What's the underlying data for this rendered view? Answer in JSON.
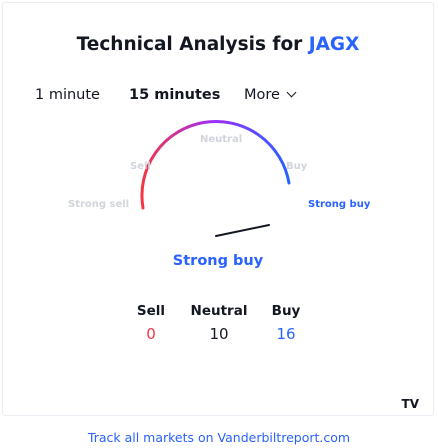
{
  "header": {
    "title_prefix": "Technical Analysis for ",
    "symbol": "JAGX"
  },
  "tabs": [
    {
      "label": "1 minute",
      "active": false
    },
    {
      "label": "15 minutes",
      "active": true
    },
    {
      "label": "More",
      "active": false
    }
  ],
  "gauge": {
    "labels": {
      "neutral": "Neutral",
      "sell": "Sell",
      "buy": "Buy",
      "strong_sell": "Strong sell",
      "strong_buy": "Strong buy"
    },
    "active": "strong_buy",
    "needle_level": 0.92
  },
  "summary": "Strong buy",
  "counts": {
    "sell": {
      "label": "Sell",
      "value": "0"
    },
    "neutral": {
      "label": "Neutral",
      "value": "10"
    },
    "buy": {
      "label": "Buy",
      "value": "16"
    }
  },
  "logo": "TV",
  "footer": "Track all markets on Vanderbiltreport.com",
  "colors": {
    "sell": "#f23645",
    "buy": "#2962ff",
    "text": "#131722",
    "inactive": "#d1d4dc",
    "needle": "#131722"
  }
}
